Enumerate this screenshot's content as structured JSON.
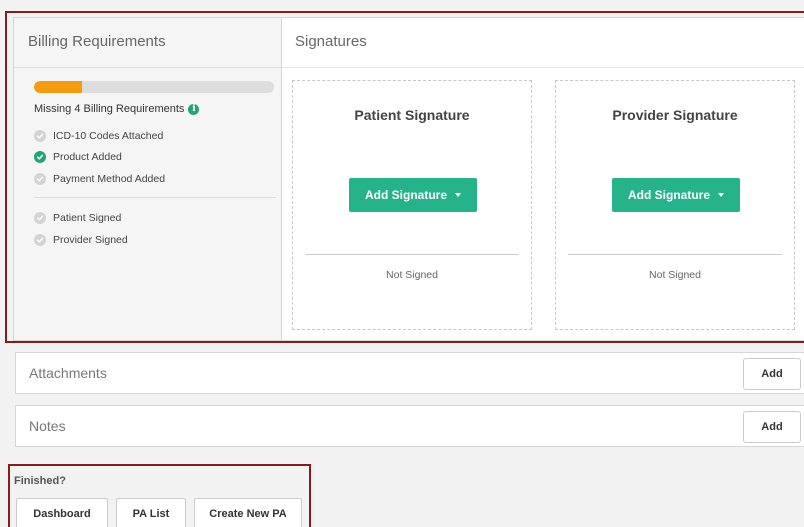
{
  "billing": {
    "header": "Billing Requirements",
    "progress_fraction": 0.2,
    "progress_color": "#f39c12",
    "missing_text": "Missing 4 Billing Requirements",
    "requirements": [
      {
        "label": "ICD-10 Codes Attached",
        "done": false
      },
      {
        "label": "Product Added",
        "done": true
      },
      {
        "label": "Payment Method Added",
        "done": false
      }
    ],
    "signatures_status": [
      {
        "label": "Patient Signed",
        "done": false
      },
      {
        "label": "Provider Signed",
        "done": false
      }
    ]
  },
  "signatures": {
    "header": "Signatures",
    "patient": {
      "title": "Patient Signature",
      "button": "Add Signature",
      "status": "Not Signed"
    },
    "provider": {
      "title": "Provider Signature",
      "button": "Add Signature",
      "status": "Not Signed"
    }
  },
  "attachments": {
    "title": "Attachments",
    "add_label": "Add"
  },
  "notes": {
    "title": "Notes",
    "add_label": "Add"
  },
  "finished": {
    "label": "Finished?",
    "dashboard": "Dashboard",
    "pa_list": "PA List",
    "create_new_pa": "Create New PA"
  },
  "colors": {
    "accent": "#26b38a",
    "highlight_border": "#8b1a1a"
  }
}
